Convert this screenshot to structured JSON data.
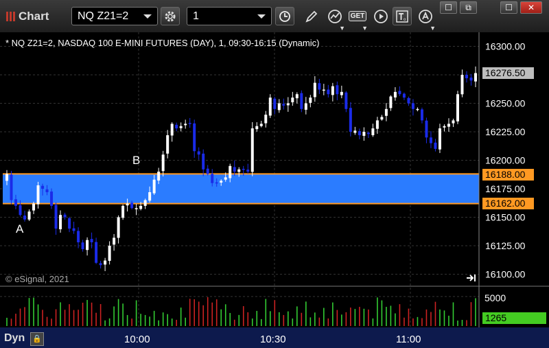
{
  "window": {
    "title": "Chart",
    "symbol": "NQ Z21=2",
    "interval": "1",
    "win_buttons": [
      "☐",
      "⧉",
      "☐",
      "✕"
    ]
  },
  "toolbar_icons": [
    "gear-icon",
    "clock-icon",
    "pencil-icon",
    "study-icon",
    "get-icon",
    "play-icon",
    "text-icon",
    "alert-icon"
  ],
  "get_label": "GET",
  "chart_title": "* NQ Z21=2, NASDAQ 100 E-MINI FUTURES (DAY), 1, 09:30-16:15 (Dynamic)",
  "copyright": "© eSignal, 2021",
  "footer": {
    "dyn": "Dyn",
    "times": [
      "10:00",
      "10:30",
      "11:00"
    ]
  },
  "price_axis": {
    "ticks": [
      "16300.00",
      "16275.00",
      "16250.00",
      "16225.00",
      "16200.00",
      "16175.00",
      "16150.00",
      "16125.00",
      "16100.00"
    ],
    "last_price": "16276.50",
    "band_high": "16188.00",
    "band_low": "16162.00"
  },
  "volume_axis": {
    "tick": "5000",
    "last_volume": "1265"
  },
  "annotations": [
    {
      "text": "A"
    },
    {
      "text": "B"
    }
  ],
  "colors": {
    "up_candle": "#ffffff",
    "down_candle": "#1a2be8",
    "band_fill": "#2b7cff",
    "band_border": "#ff9922",
    "last_price_tag": "#bdbdbd",
    "volume_up": "#33cc33",
    "volume_down": "#cc2222",
    "volume_tag": "#44cc22",
    "grid": "#333333"
  },
  "chart_data": {
    "type": "candlestick",
    "y_range": [
      16090,
      16310
    ],
    "x_time_range": [
      "09:30",
      "11:20"
    ],
    "band": [
      16162,
      16188
    ],
    "closes": [
      16188,
      16165,
      16160,
      16152,
      16148,
      16155,
      16162,
      16178,
      16175,
      16172,
      16160,
      16140,
      16152,
      16150,
      16140,
      16138,
      16128,
      16122,
      16130,
      16128,
      16110,
      16108,
      16112,
      16125,
      16132,
      16150,
      16160,
      16162,
      16158,
      16158,
      16160,
      16165,
      16172,
      16183,
      16190,
      16205,
      16222,
      16232,
      16228,
      16230,
      16232,
      16232,
      16208,
      16205,
      16192,
      16188,
      16180,
      16180,
      16182,
      16185,
      16195,
      16190,
      16192,
      16192,
      16190,
      16228,
      16230,
      16232,
      16240,
      16255,
      16245,
      16250,
      16248,
      16250,
      16255,
      16258,
      16245,
      16250,
      16255,
      16268,
      16262,
      16262,
      16258,
      16265,
      16258,
      16260,
      16245,
      16225,
      16226,
      16222,
      16225,
      16223,
      16228,
      16235,
      16238,
      16245,
      16256,
      16260,
      16258,
      16255,
      16250,
      16245,
      16245,
      16235,
      16220,
      16215,
      16210,
      16228,
      16230,
      16232,
      16235,
      16258,
      16275,
      16272,
      16270,
      16276.5
    ]
  }
}
